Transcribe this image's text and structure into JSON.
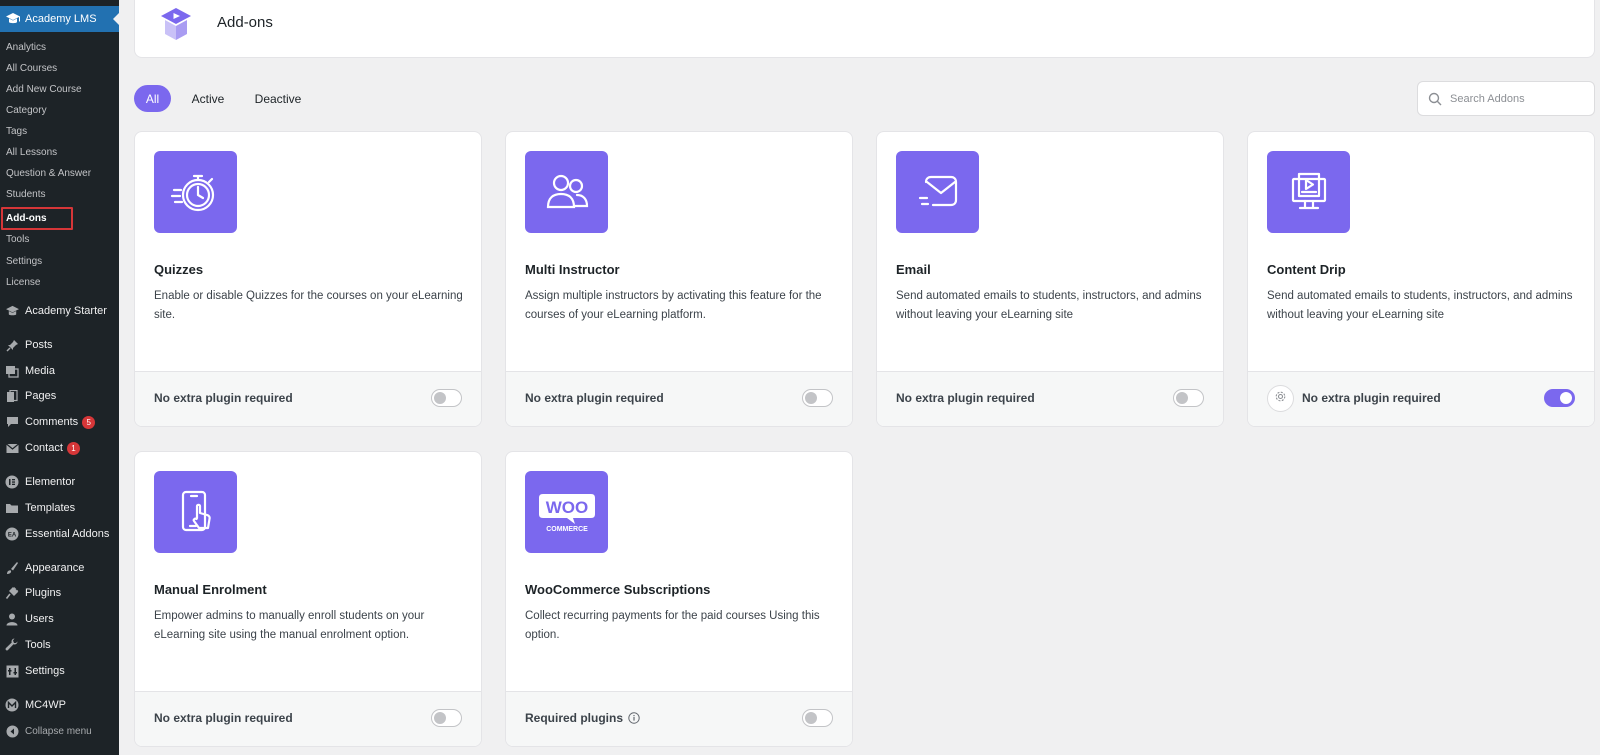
{
  "sidebar": {
    "header_label": "Academy LMS",
    "submenu": [
      {
        "label": "Analytics"
      },
      {
        "label": "All Courses"
      },
      {
        "label": "Add New Course"
      },
      {
        "label": "Category"
      },
      {
        "label": "Tags"
      },
      {
        "label": "All Lessons"
      },
      {
        "label": "Question & Answer"
      },
      {
        "label": "Students"
      },
      {
        "label": "Add-ons",
        "current": true
      },
      {
        "label": "Tools"
      },
      {
        "label": "Settings"
      },
      {
        "label": "License"
      }
    ],
    "menu": [
      {
        "label": "Academy Starter",
        "icon": "academy-starter-icon"
      },
      {
        "label": "Posts",
        "icon": "pushpin-icon"
      },
      {
        "label": "Media",
        "icon": "media-icon"
      },
      {
        "label": "Pages",
        "icon": "pages-icon"
      },
      {
        "label": "Comments",
        "icon": "comments-icon",
        "badge": "5"
      },
      {
        "label": "Contact",
        "icon": "mail-icon",
        "badge": "1"
      },
      {
        "label": "Elementor",
        "icon": "elementor-icon"
      },
      {
        "label": "Templates",
        "icon": "folder-icon"
      },
      {
        "label": "Essential Addons",
        "icon": "essential-addons-icon"
      },
      {
        "label": "Appearance",
        "icon": "brush-icon"
      },
      {
        "label": "Plugins",
        "icon": "plugin-icon"
      },
      {
        "label": "Users",
        "icon": "user-icon"
      },
      {
        "label": "Tools",
        "icon": "wrench-icon"
      },
      {
        "label": "Settings",
        "icon": "settings-icon"
      },
      {
        "label": "MC4WP",
        "icon": "mc4wp-icon"
      },
      {
        "label": "Collapse menu",
        "icon": "collapse-icon"
      }
    ]
  },
  "header": {
    "title": "Add-ons"
  },
  "filters": {
    "tabs": [
      {
        "label": "All",
        "active": true
      },
      {
        "label": "Active",
        "active": false
      },
      {
        "label": "Deactive",
        "active": false
      }
    ],
    "search_placeholder": "Search Addons"
  },
  "addons": [
    {
      "title": "Quizzes",
      "description": "Enable or disable Quizzes for the courses on your eLearning site.",
      "footer": "No extra plugin required",
      "enabled": false,
      "icon": "stopwatch-icon"
    },
    {
      "title": "Multi Instructor",
      "description": "Assign multiple instructors by activating this feature for the courses of your eLearning platform.",
      "footer": "No extra plugin required",
      "enabled": false,
      "icon": "users-icon"
    },
    {
      "title": "Email",
      "description": "Send automated emails to students, instructors, and admins without leaving your eLearning site",
      "footer": "No extra plugin required",
      "enabled": false,
      "icon": "envelope-icon"
    },
    {
      "title": "Content Drip",
      "description": "Send automated emails to students, instructors, and admins without leaving your eLearning site",
      "footer": "No extra plugin required",
      "enabled": true,
      "icon": "video-screen-icon"
    },
    {
      "title": "Manual Enrolment",
      "description": "Empower admins to manually enroll students on your eLearning site using the manual enrolment option.",
      "footer": "No extra plugin required",
      "enabled": false,
      "icon": "phone-tap-icon"
    },
    {
      "title": "WooCommerce Subscriptions",
      "description": "Collect recurring payments for the paid courses Using this option.",
      "footer": "Required plugins",
      "enabled": false,
      "icon": "woocommerce-logo-icon"
    }
  ],
  "colors": {
    "accent": "#7b68ee",
    "sidebar_bg": "#1d2327",
    "sidebar_active": "#2271b1",
    "badge": "#d63638"
  }
}
